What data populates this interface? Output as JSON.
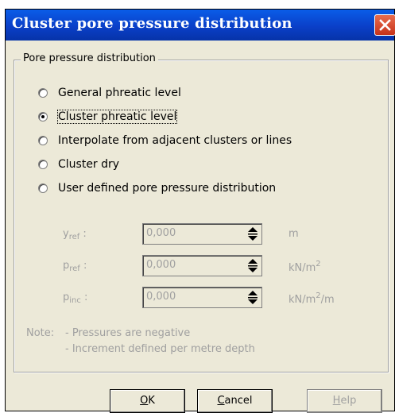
{
  "window": {
    "title": "Cluster pore pressure distribution"
  },
  "group": {
    "legend": "Pore pressure distribution"
  },
  "radios": [
    {
      "label": "General phreatic level",
      "checked": false
    },
    {
      "label": "Cluster phreatic level",
      "checked": true
    },
    {
      "label": "Interpolate from adjacent clusters or lines",
      "checked": false
    },
    {
      "label": "Cluster dry",
      "checked": false
    },
    {
      "label": "User defined pore pressure distribution",
      "checked": false
    }
  ],
  "params": [
    {
      "symbol": "y",
      "subscript": "ref",
      "suffix": ":",
      "value": "0,000",
      "unit_base": "m",
      "unit_sup": "",
      "unit_tail": ""
    },
    {
      "symbol": "p",
      "subscript": "ref",
      "suffix": ":",
      "value": "0,000",
      "unit_base": "kN/m",
      "unit_sup": "2",
      "unit_tail": ""
    },
    {
      "symbol": "p",
      "subscript": "inc",
      "suffix": ":",
      "value": "0,000",
      "unit_base": "kN/m",
      "unit_sup": "2",
      "unit_tail": "/m"
    }
  ],
  "note": {
    "label": "Note:",
    "line1": "- Pressures are negative",
    "line2": "- Increment defined per metre depth"
  },
  "buttons": {
    "ok": {
      "hotkey": "O",
      "rest": "K"
    },
    "cancel": {
      "hotkey": "C",
      "rest": "ancel"
    },
    "help": {
      "hotkey": "H",
      "rest": "elp"
    }
  },
  "colors": {
    "titlebar": "#0a4fd8",
    "dialog_bg": "#ece9d8",
    "disabled_text": "#a0a0a0",
    "close_button": "#d8472a"
  },
  "icons": {
    "close": "close-icon",
    "spin": "spin-arrows-icon"
  }
}
